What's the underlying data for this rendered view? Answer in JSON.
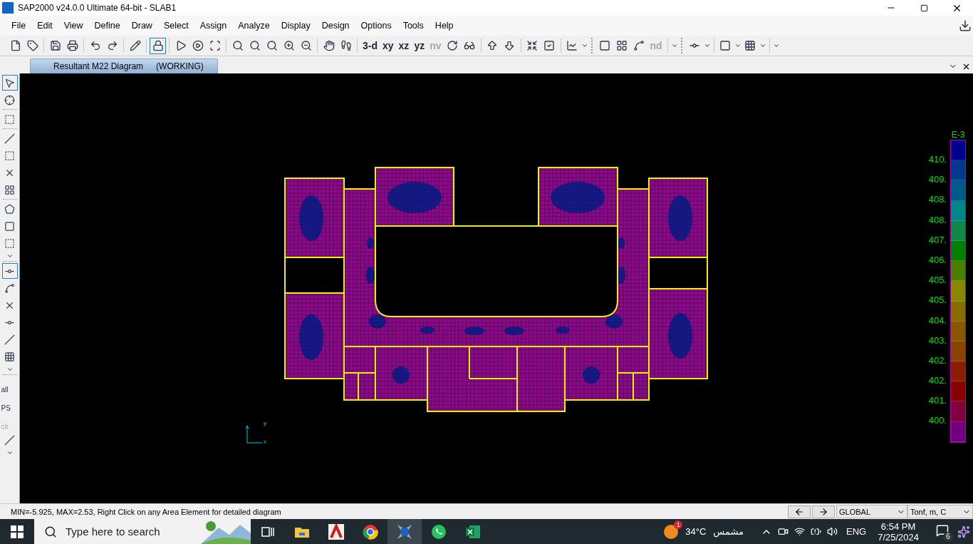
{
  "window": {
    "title": "SAP2000 v24.0.0 Ultimate 64-bit - SLAB1"
  },
  "menu": [
    "File",
    "Edit",
    "View",
    "Define",
    "Draw",
    "Select",
    "Assign",
    "Analyze",
    "Display",
    "Design",
    "Options",
    "Tools",
    "Help"
  ],
  "toolbar": {
    "lock_on": true,
    "view_buttons": [
      {
        "label": "3-d",
        "disabled": false
      },
      {
        "label": "xy",
        "disabled": false
      },
      {
        "label": "xz",
        "disabled": false
      },
      {
        "label": "yz",
        "disabled": false
      },
      {
        "label": "nv",
        "disabled": true
      }
    ],
    "node_button": {
      "label": "nd",
      "disabled": true
    }
  },
  "document_tab": {
    "title": "Resultant M22 Diagram",
    "status": "(WORKING)",
    "selected": true
  },
  "left_toolbar": {
    "pointer_selected": true,
    "snap_selected": true,
    "select_buttons": [
      {
        "label": "all",
        "disabled": false
      },
      {
        "label": "PS",
        "disabled": false
      },
      {
        "label": "clr",
        "disabled": true
      }
    ]
  },
  "canvas": {
    "axes": {
      "x": "x",
      "y": "y"
    },
    "legend": {
      "exponent": "E-3",
      "labels": [
        "410.",
        "409.",
        "408.",
        "408.",
        "407.",
        "406.",
        "405.",
        "405.",
        "404.",
        "403.",
        "402.",
        "402.",
        "401.",
        "400."
      ],
      "segments": [
        {
          "color": "#000090"
        },
        {
          "color": "#003a8a"
        },
        {
          "color": "#005a8c"
        },
        {
          "color": "#008888"
        },
        {
          "color": "#108848"
        },
        {
          "color": "#008000"
        },
        {
          "color": "#4a8000"
        },
        {
          "color": "#888800"
        },
        {
          "color": "#886c00"
        },
        {
          "color": "#885800"
        },
        {
          "color": "#884400"
        },
        {
          "color": "#882000"
        },
        {
          "color": "#880000"
        },
        {
          "color": "#800040"
        },
        {
          "color": "#700080"
        }
      ]
    }
  },
  "status_bar": {
    "message": "MIN=-5.925, MAX=2.53, Right Click on any Area Element for detailed diagram",
    "coordinate_system": "GLOBAL",
    "units": "Tonf, m, C"
  },
  "taskbar": {
    "search_placeholder": "Type here to search",
    "apps": [
      {
        "kind": "task-view",
        "selected": false
      },
      {
        "kind": "folder",
        "selected": false
      },
      {
        "kind": "cad",
        "selected": false
      },
      {
        "kind": "browser",
        "selected": false
      },
      {
        "kind": "structure",
        "selected": true
      },
      {
        "kind": "chat",
        "selected": false
      },
      {
        "kind": "sheet",
        "selected": false
      }
    ],
    "weather": {
      "temperature": "34°C",
      "condition": "مشمس",
      "badge": "1"
    },
    "language": "ENG",
    "time": "6:54 PM",
    "date": "7/25/2024",
    "notifications": "6"
  }
}
